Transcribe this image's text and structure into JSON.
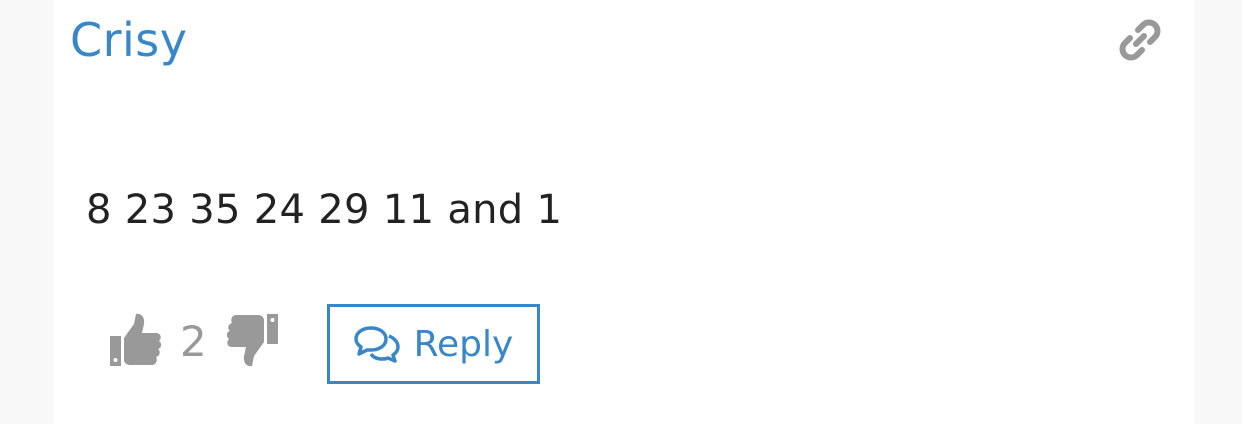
{
  "comment": {
    "author": "Crisy",
    "text": "8 23 35 24 29 11 and 1",
    "permalink_icon": "link-icon",
    "votes": {
      "upvote_icon": "thumbs-up-icon",
      "count": "2",
      "downvote_icon": "thumbs-down-icon"
    },
    "reply": {
      "label": "Reply",
      "icon": "comments-icon"
    }
  },
  "colors": {
    "accent": "#3a87c7",
    "icon_gray": "#999999",
    "text": "#222222"
  }
}
